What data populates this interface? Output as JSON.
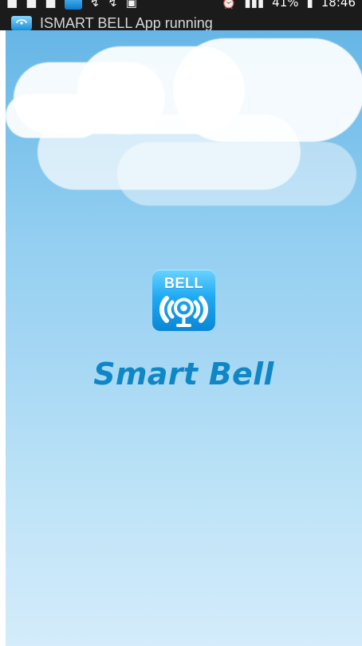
{
  "status_bar": {
    "battery_text": "41%",
    "time": "18:46"
  },
  "notification": {
    "text": "ISMART BELL App running"
  },
  "splash": {
    "icon_label": "BELL",
    "app_name": "Smart Bell"
  },
  "icons": {
    "app_icon": "wireless-bell-icon",
    "notification_app_icon": "app-icon",
    "status_icons": [
      "square-icon",
      "square-icon",
      "square-icon",
      "app-icon",
      "wifi-call-icon",
      "wifi-call-icon",
      "image-icon",
      "alarm-icon",
      "signal-icon",
      "battery-icon"
    ]
  },
  "colors": {
    "title": "#0f87c6",
    "icon_gradient_top": "#6ad3ff",
    "icon_gradient_bottom": "#0a86d5"
  }
}
